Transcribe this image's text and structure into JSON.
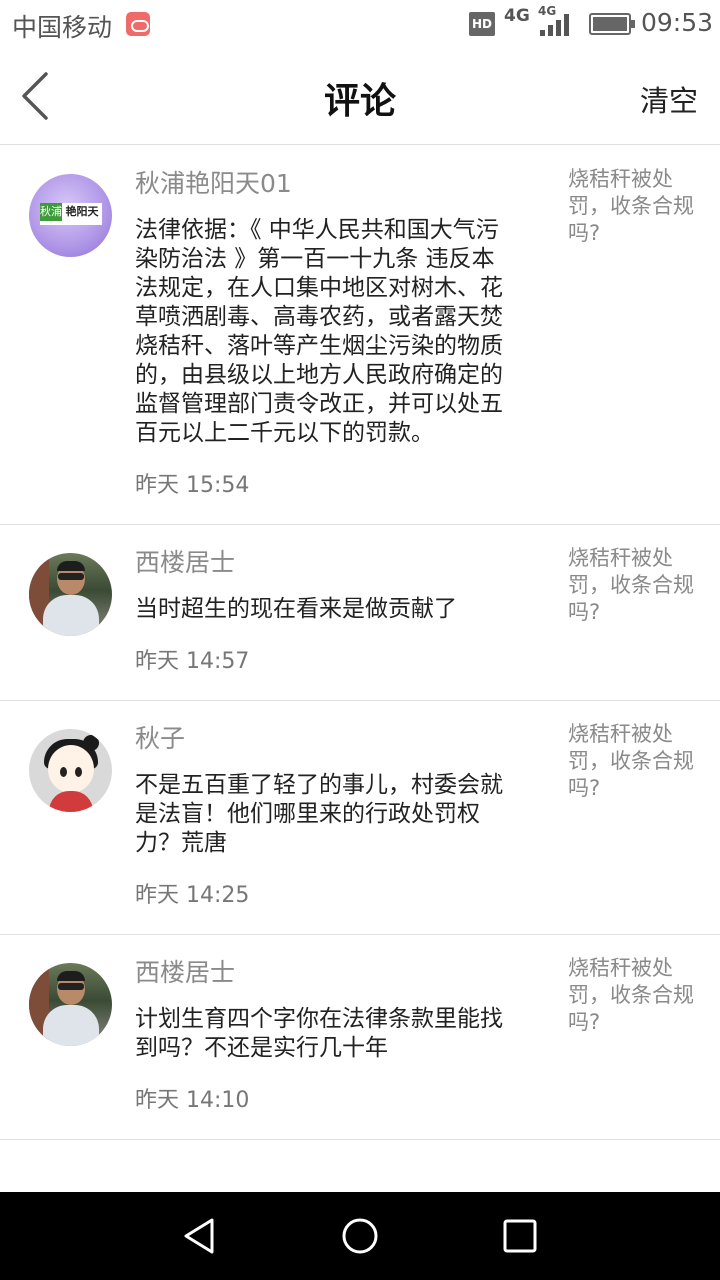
{
  "status_bar": {
    "carrier": "中国移动",
    "hd": "HD",
    "network_primary": "4G",
    "network_secondary": "4G",
    "time": "09:53"
  },
  "header": {
    "title": "评论",
    "clear_label": "清空",
    "back_icon": "chevron-left-icon"
  },
  "comments": [
    {
      "avatar": "logo-avatar",
      "avatar_logo_text_left": "秋浦",
      "avatar_logo_text_right": "艳阳天",
      "name": "秋浦艳阳天01",
      "text": "法律依据：《 中华人民共和国大气污染防治法 》第一百一十九条 违反本法规定，在人口集中地区对树木、花草喷洒剧毒、高毒农药，或者露天焚烧秸秆、落叶等产生烟尘污染的物质的，由县级以上地方人民政府确定的监督管理部门责令改正，并可以处五百元以上二千元以下的罚款。",
      "time": "昨天 15:54",
      "article": "烧秸秆被处罚，收条合规吗?"
    },
    {
      "avatar": "photo-avatar",
      "name": "西楼居士",
      "text": "当时超生的现在看来是做贡献了",
      "time": "昨天 14:57",
      "article": "烧秸秆被处罚，收条合规吗?"
    },
    {
      "avatar": "cartoon-avatar",
      "name": "秋子",
      "text": "不是五百重了轻了的事儿，村委会就是法盲！他们哪里来的行政处罚权力？荒唐",
      "time": "昨天 14:25",
      "article": "烧秸秆被处罚，收条合规吗?"
    },
    {
      "avatar": "photo-avatar",
      "name": "西楼居士",
      "text": "计划生育四个字你在法律条款里能找到吗？不还是实行几十年",
      "time": "昨天 14:10",
      "article": "烧秸秆被处罚，收条合规吗?"
    }
  ],
  "nav_bar": {
    "back_icon": "triangle-back-icon",
    "home_icon": "circle-home-icon",
    "recent_icon": "square-recent-icon"
  },
  "colors": {
    "background": "#ffffff",
    "divider": "#e0e0e0",
    "name_gray": "#8a8a8a",
    "nav_black": "#000000"
  }
}
